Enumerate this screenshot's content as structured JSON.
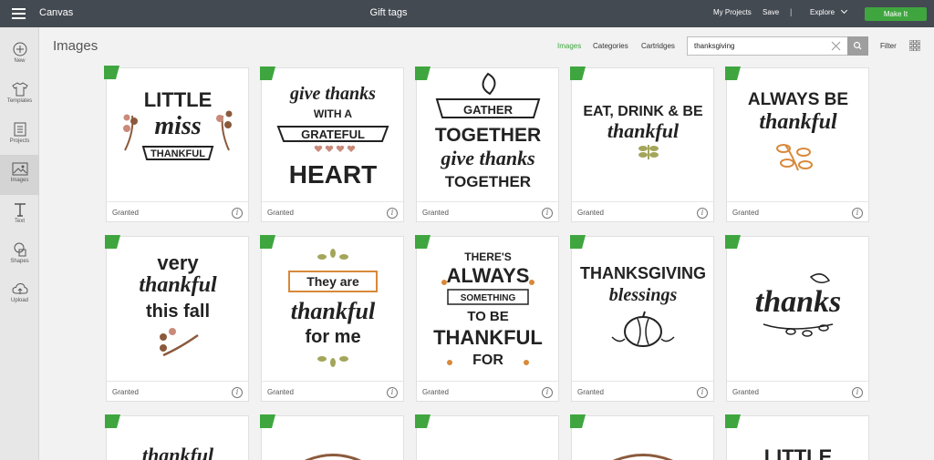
{
  "topbar": {
    "app_title": "Canvas",
    "document_title": "Gift tags",
    "my_projects": "My Projects",
    "save": "Save",
    "separator": "|",
    "explore": "Explore",
    "make_it": "Make It"
  },
  "sidebar": {
    "items": [
      {
        "label": "New",
        "icon": "plus-circle-icon"
      },
      {
        "label": "Templates",
        "icon": "shirt-icon"
      },
      {
        "label": "Projects",
        "icon": "projects-icon"
      },
      {
        "label": "Images",
        "icon": "image-icon",
        "active": true
      },
      {
        "label": "Text",
        "icon": "text-icon"
      },
      {
        "label": "Shapes",
        "icon": "shapes-icon"
      },
      {
        "label": "Upload",
        "icon": "upload-cloud-icon"
      }
    ]
  },
  "header": {
    "title": "Images",
    "tabs": [
      {
        "label": "Images",
        "active": true
      },
      {
        "label": "Categories",
        "active": false
      },
      {
        "label": "Cartridges",
        "active": false
      }
    ],
    "search_value": "thanksgiving",
    "filter": "Filter"
  },
  "colors": {
    "accent_green": "#3fa63f",
    "topbar": "#444a52",
    "brown": "#8b5a3c",
    "olive": "#a3a65a",
    "pink": "#c98a7a",
    "orange": "#d8893a"
  },
  "cards": [
    {
      "status": "Granted",
      "art": [
        "LITTLE",
        "miss",
        "THANKFUL"
      ]
    },
    {
      "status": "Granted",
      "art": [
        "give thanks",
        "WITH A",
        "GRATEFUL",
        "HEART"
      ]
    },
    {
      "status": "Granted",
      "art": [
        "GATHER",
        "TOGETHER",
        "give thanks",
        "TOGETHER"
      ]
    },
    {
      "status": "Granted",
      "art": [
        "EAT, DRINK & BE",
        "thankful"
      ]
    },
    {
      "status": "Granted",
      "art": [
        "ALWAYS BE",
        "thankful"
      ]
    },
    {
      "status": "Granted",
      "art": [
        "very",
        "thankful",
        "this fall"
      ]
    },
    {
      "status": "Granted",
      "art": [
        "They are",
        "thankful",
        "for me"
      ]
    },
    {
      "status": "Granted",
      "art": [
        "THERE'S",
        "ALWAYS",
        "SOMETHING",
        "TO BE",
        "THANKFUL",
        "FOR"
      ]
    },
    {
      "status": "Granted",
      "art": [
        "THANKSGIVING",
        "blessings"
      ]
    },
    {
      "status": "Granted",
      "art": [
        "thanks"
      ]
    },
    {
      "status": "",
      "art": [
        "thankful"
      ]
    },
    {
      "status": "",
      "art": []
    },
    {
      "status": "",
      "art": []
    },
    {
      "status": "",
      "art": []
    },
    {
      "status": "",
      "art": [
        "LITTLE"
      ]
    }
  ]
}
